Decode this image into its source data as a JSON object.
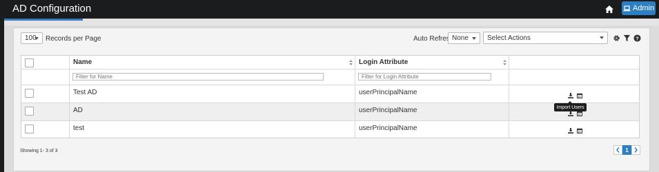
{
  "app": {
    "title": "AD Configuration"
  },
  "header": {
    "admin_label": "Admin"
  },
  "toolbar": {
    "records_per_page_value": "100",
    "records_per_page_label": "Records per Page",
    "auto_refresh_label": "Auto Refresh:",
    "auto_refresh_value": "None",
    "select_actions_value": "Select Actions"
  },
  "table": {
    "columns": [
      "Name",
      "Login Attribute"
    ],
    "filters": {
      "name_placeholder": "Filter for Name",
      "login_placeholder": "Filter for Login Attribute"
    },
    "rows": [
      {
        "name": "Test AD",
        "login_attribute": "userPrincipalName"
      },
      {
        "name": "AD",
        "login_attribute": "userPrincipalName"
      },
      {
        "name": "test",
        "login_attribute": "userPrincipalName"
      }
    ]
  },
  "tooltip": {
    "text": "Import Users"
  },
  "footer": {
    "showing_text": "Showing 1- 3 of 3",
    "current_page": "1"
  },
  "colors": {
    "accent": "#2d7fc1",
    "topbar": "#1b1c1e"
  },
  "icons": [
    "home-icon",
    "laptop-icon",
    "gear-icon",
    "filter-icon",
    "help-icon",
    "download-icon",
    "calendar-icon",
    "chevron-left-icon",
    "chevron-right-icon"
  ]
}
